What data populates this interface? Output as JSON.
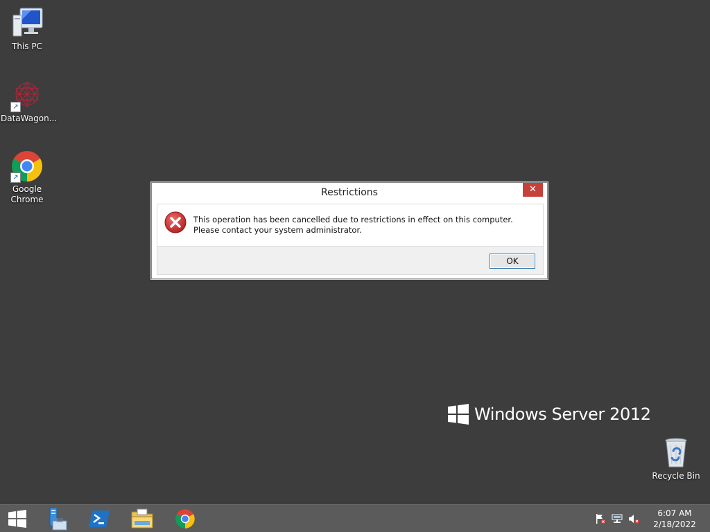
{
  "desktop": {
    "icons": [
      {
        "label": "This PC",
        "icon": "this-pc-icon"
      },
      {
        "label": "DataWagon...",
        "icon": "datawagon-icon"
      },
      {
        "label": "Google Chrome",
        "icon": "chrome-icon"
      },
      {
        "label": "Recycle Bin",
        "icon": "recycle-bin-icon"
      }
    ],
    "branding": "Windows Server 2012",
    "background_color": "#3d3d3d"
  },
  "dialog": {
    "title": "Restrictions",
    "close_label": "✕",
    "message": "This operation has been cancelled due to restrictions in effect on this computer. Please contact your system administrator.",
    "ok_label": "OK",
    "icon": "error-icon",
    "close_color": "#c7413b"
  },
  "taskbar": {
    "items": [
      {
        "icon": "start-icon"
      },
      {
        "icon": "server-manager-icon"
      },
      {
        "icon": "powershell-icon"
      },
      {
        "icon": "file-explorer-icon"
      },
      {
        "icon": "chrome-icon"
      }
    ],
    "tray": [
      {
        "icon": "action-center-icon"
      },
      {
        "icon": "network-icon"
      },
      {
        "icon": "volume-muted-icon"
      }
    ],
    "clock": {
      "time": "6:07 AM",
      "date": "2/18/2022"
    }
  }
}
